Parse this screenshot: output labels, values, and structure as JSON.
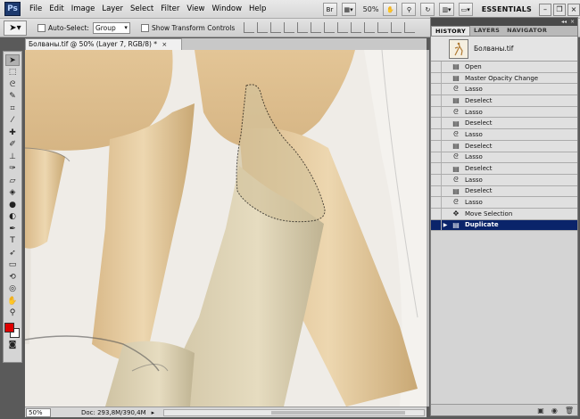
{
  "app": {
    "logo": "Ps"
  },
  "menu": [
    "File",
    "Edit",
    "Image",
    "Layer",
    "Select",
    "Filter",
    "View",
    "Window",
    "Help"
  ],
  "menubar_right": {
    "bridge": "Br",
    "zoom": "50%",
    "workspace": "ESSENTIALS"
  },
  "options": {
    "auto_select_label": "Auto-Select:",
    "auto_select_value": "Group",
    "transform_label": "Show Transform Controls"
  },
  "document": {
    "tab_title": "Болваны.tif @ 50% (Layer 7, RGB/8) *"
  },
  "status": {
    "zoom": "50%",
    "doc_size": "Doc: 293,8M/390,4M"
  },
  "colors": {
    "foreground": "#e00000",
    "background": "#ffffff",
    "selection": "#0a246a"
  },
  "panel": {
    "tabs": [
      "HISTORY",
      "LAYERS",
      "NAVIGATOR"
    ],
    "snapshot_name": "Болваны.tif",
    "history": [
      {
        "label": "Open",
        "icon": "document-icon",
        "glyph": "▤"
      },
      {
        "label": "Master Opacity Change",
        "icon": "document-icon",
        "glyph": "▤"
      },
      {
        "label": "Lasso",
        "icon": "lasso-icon",
        "glyph": "ᘓ"
      },
      {
        "label": "Deselect",
        "icon": "document-icon",
        "glyph": "▤"
      },
      {
        "label": "Lasso",
        "icon": "lasso-icon",
        "glyph": "ᘓ"
      },
      {
        "label": "Deselect",
        "icon": "document-icon",
        "glyph": "▤"
      },
      {
        "label": "Lasso",
        "icon": "lasso-icon",
        "glyph": "ᘓ"
      },
      {
        "label": "Deselect",
        "icon": "document-icon",
        "glyph": "▤"
      },
      {
        "label": "Lasso",
        "icon": "lasso-icon",
        "glyph": "ᘓ"
      },
      {
        "label": "Deselect",
        "icon": "document-icon",
        "glyph": "▤"
      },
      {
        "label": "Lasso",
        "icon": "lasso-icon",
        "glyph": "ᘓ"
      },
      {
        "label": "Deselect",
        "icon": "document-icon",
        "glyph": "▤"
      },
      {
        "label": "Lasso",
        "icon": "lasso-icon",
        "glyph": "ᘓ"
      },
      {
        "label": "Move Selection",
        "icon": "move-icon",
        "glyph": "✥"
      },
      {
        "label": "Duplicate",
        "icon": "document-icon",
        "glyph": "▤",
        "selected": true
      }
    ]
  }
}
